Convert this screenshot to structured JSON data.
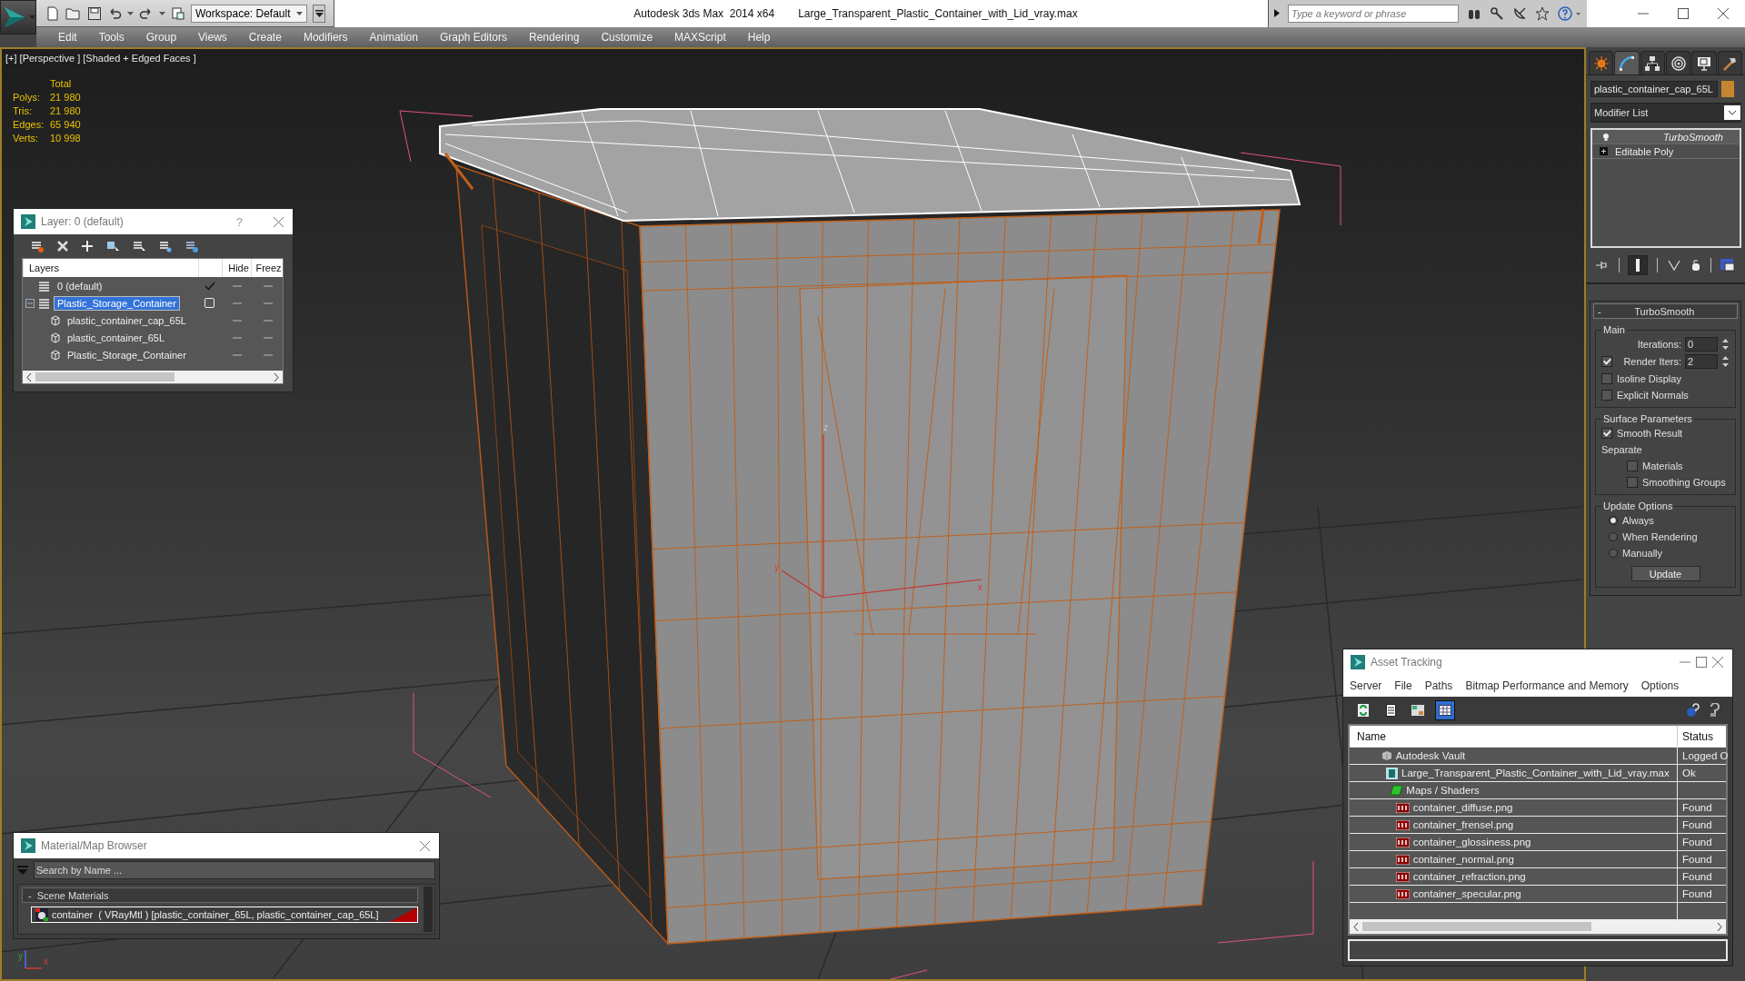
{
  "title_bar": {
    "workspace": "Workspace: Default",
    "app": "Autodesk 3ds Max  2014 x64",
    "file": "Large_Transparent_Plastic_Container_with_Lid_vray.max",
    "search": {
      "placeholder": "Type a keyword or phrase"
    }
  },
  "menu": [
    "Edit",
    "Tools",
    "Group",
    "Views",
    "Create",
    "Modifiers",
    "Animation",
    "Graph Editors",
    "Rendering",
    "Customize",
    "MAXScript",
    "Help"
  ],
  "viewport": {
    "label": "[+] [Perspective ] [Shaded + Edged Faces ]",
    "active": true,
    "stats_header": "Total",
    "stats": [
      {
        "label": "Polys:",
        "value": "21 980"
      },
      {
        "label": "Tris:",
        "value": "21 980"
      },
      {
        "label": "Edges:",
        "value": "65 940"
      },
      {
        "label": "Verts:",
        "value": "10 998"
      }
    ],
    "pivot_axes": {
      "x": "x",
      "y": "y",
      "z": "z"
    },
    "world_axes": {
      "x": "x",
      "y": "y"
    }
  },
  "layer_dialog": {
    "title": "Layer: 0 (default)",
    "help": "?",
    "columns": [
      "Layers",
      "Hide",
      "Freez"
    ],
    "layers": [
      {
        "name": "0 (default)",
        "kind": "layer",
        "selected": false,
        "current": true,
        "expanded": false,
        "hidden": false,
        "frozen": false
      },
      {
        "name": "Plastic_Storage_Container",
        "kind": "layer",
        "selected": true,
        "current": false,
        "expanded": true,
        "hidden": false,
        "frozen": false,
        "children": [
          {
            "name": "plastic_container_cap_65L",
            "kind": "object",
            "hidden": false,
            "frozen": false
          },
          {
            "name": "plastic_container_65L",
            "kind": "object",
            "hidden": false,
            "frozen": false
          },
          {
            "name": "Plastic_Storage_Container",
            "kind": "object",
            "hidden": false,
            "frozen": false
          }
        ]
      }
    ]
  },
  "command_panel": {
    "tabs": [
      {
        "kind": "create",
        "selected": false
      },
      {
        "kind": "modify",
        "selected": true
      },
      {
        "kind": "hierarchy",
        "selected": false
      },
      {
        "kind": "motion",
        "selected": false
      },
      {
        "kind": "display",
        "selected": false
      },
      {
        "kind": "utilities",
        "selected": false
      }
    ],
    "object": {
      "name": "plastic_container_cap_65L",
      "color": "#c8852f"
    },
    "modifier_list": "Modifier List",
    "stack": [
      {
        "name": "TurboSmooth",
        "kind": "modifier"
      },
      {
        "name": "Editable Poly",
        "kind": "base"
      }
    ],
    "rollout": {
      "title": "TurboSmooth",
      "toggle": "-",
      "groups": [
        {
          "title": "Main",
          "controls": [
            {
              "kind": "spinner",
              "label": "Iterations:",
              "value": "0"
            },
            {
              "kind": "check-spinner",
              "label": "Render Iters:",
              "value": "2",
              "checked": true
            },
            {
              "kind": "checkbox",
              "label": "Isoline Display",
              "checked": false
            },
            {
              "kind": "checkbox",
              "label": "Explicit Normals",
              "checked": false
            }
          ]
        },
        {
          "title": "Surface Parameters",
          "controls": [
            {
              "kind": "checkbox",
              "label": "Smooth Result",
              "checked": true
            },
            {
              "kind": "label",
              "label": "Separate"
            },
            {
              "kind": "sub-checkbox",
              "label": "Materials",
              "checked": false
            },
            {
              "kind": "sub-checkbox",
              "label": "Smoothing Groups",
              "checked": false
            }
          ]
        },
        {
          "title": "Update Options",
          "controls": [
            {
              "kind": "radio",
              "label": "Always",
              "selected": true
            },
            {
              "kind": "radio",
              "label": "When Rendering",
              "selected": false
            },
            {
              "kind": "radio",
              "label": "Manually",
              "selected": false
            },
            {
              "kind": "button",
              "label": "Update"
            }
          ]
        }
      ]
    }
  },
  "material_browser": {
    "title": "Material/Map Browser",
    "search": {
      "placeholder": "Search by Name ..."
    },
    "group": {
      "toggle": "-",
      "title": "Scene Materials"
    },
    "materials": [
      {
        "name": "container",
        "type": "( VRayMtl )",
        "objects": "[plastic_container_65L, plastic_container_cap_65L]",
        "selected": true
      }
    ]
  },
  "asset_tracking": {
    "title": "Asset Tracking",
    "menu": [
      "Server",
      "File",
      "Paths",
      "Bitmap Performance and Memory",
      "Options"
    ],
    "toolbar": [
      {
        "kind": "refresh",
        "selected": false
      },
      {
        "kind": "list",
        "selected": false
      },
      {
        "kind": "thumbnails",
        "selected": false
      },
      {
        "kind": "table",
        "selected": true
      }
    ],
    "columns": [
      "Name",
      "Status"
    ],
    "assets": [
      {
        "name": "Autodesk Vault",
        "kind": "vault",
        "status": "Logged O",
        "children": [
          {
            "name": "Large_Transparent_Plastic_Container_with_Lid_vray.max",
            "kind": "max",
            "status": "Ok",
            "children": [
              {
                "name": "Maps / Shaders",
                "kind": "folder",
                "children": [
                  {
                    "name": "container_diffuse.png",
                    "kind": "png",
                    "status": "Found"
                  },
                  {
                    "name": "container_frensel.png",
                    "kind": "png",
                    "status": "Found"
                  },
                  {
                    "name": "container_glossiness.png",
                    "kind": "png",
                    "status": "Found"
                  },
                  {
                    "name": "container_normal.png",
                    "kind": "png",
                    "status": "Found"
                  },
                  {
                    "name": "container_refraction.png",
                    "kind": "png",
                    "status": "Found"
                  },
                  {
                    "name": "container_specular.png",
                    "kind": "png",
                    "status": "Found"
                  }
                ]
              }
            ]
          }
        ]
      }
    ]
  }
}
